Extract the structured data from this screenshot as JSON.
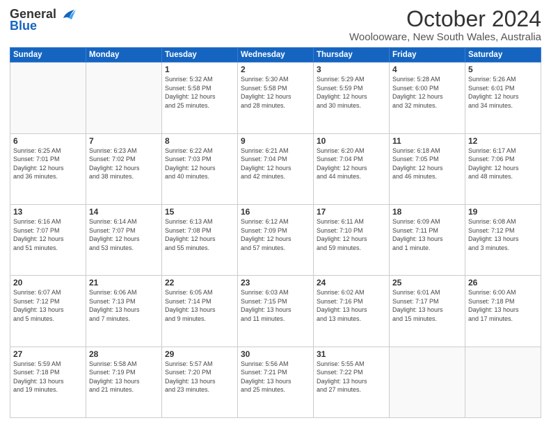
{
  "header": {
    "logo": {
      "general": "General",
      "blue": "Blue"
    },
    "title": "October 2024",
    "subtitle": "Woolooware, New South Wales, Australia"
  },
  "calendar": {
    "headers": [
      "Sunday",
      "Monday",
      "Tuesday",
      "Wednesday",
      "Thursday",
      "Friday",
      "Saturday"
    ],
    "weeks": [
      [
        {
          "day": "",
          "info": ""
        },
        {
          "day": "",
          "info": ""
        },
        {
          "day": "1",
          "info": "Sunrise: 5:32 AM\nSunset: 5:58 PM\nDaylight: 12 hours\nand 25 minutes."
        },
        {
          "day": "2",
          "info": "Sunrise: 5:30 AM\nSunset: 5:58 PM\nDaylight: 12 hours\nand 28 minutes."
        },
        {
          "day": "3",
          "info": "Sunrise: 5:29 AM\nSunset: 5:59 PM\nDaylight: 12 hours\nand 30 minutes."
        },
        {
          "day": "4",
          "info": "Sunrise: 5:28 AM\nSunset: 6:00 PM\nDaylight: 12 hours\nand 32 minutes."
        },
        {
          "day": "5",
          "info": "Sunrise: 5:26 AM\nSunset: 6:01 PM\nDaylight: 12 hours\nand 34 minutes."
        }
      ],
      [
        {
          "day": "6",
          "info": "Sunrise: 6:25 AM\nSunset: 7:01 PM\nDaylight: 12 hours\nand 36 minutes."
        },
        {
          "day": "7",
          "info": "Sunrise: 6:23 AM\nSunset: 7:02 PM\nDaylight: 12 hours\nand 38 minutes."
        },
        {
          "day": "8",
          "info": "Sunrise: 6:22 AM\nSunset: 7:03 PM\nDaylight: 12 hours\nand 40 minutes."
        },
        {
          "day": "9",
          "info": "Sunrise: 6:21 AM\nSunset: 7:04 PM\nDaylight: 12 hours\nand 42 minutes."
        },
        {
          "day": "10",
          "info": "Sunrise: 6:20 AM\nSunset: 7:04 PM\nDaylight: 12 hours\nand 44 minutes."
        },
        {
          "day": "11",
          "info": "Sunrise: 6:18 AM\nSunset: 7:05 PM\nDaylight: 12 hours\nand 46 minutes."
        },
        {
          "day": "12",
          "info": "Sunrise: 6:17 AM\nSunset: 7:06 PM\nDaylight: 12 hours\nand 48 minutes."
        }
      ],
      [
        {
          "day": "13",
          "info": "Sunrise: 6:16 AM\nSunset: 7:07 PM\nDaylight: 12 hours\nand 51 minutes."
        },
        {
          "day": "14",
          "info": "Sunrise: 6:14 AM\nSunset: 7:07 PM\nDaylight: 12 hours\nand 53 minutes."
        },
        {
          "day": "15",
          "info": "Sunrise: 6:13 AM\nSunset: 7:08 PM\nDaylight: 12 hours\nand 55 minutes."
        },
        {
          "day": "16",
          "info": "Sunrise: 6:12 AM\nSunset: 7:09 PM\nDaylight: 12 hours\nand 57 minutes."
        },
        {
          "day": "17",
          "info": "Sunrise: 6:11 AM\nSunset: 7:10 PM\nDaylight: 12 hours\nand 59 minutes."
        },
        {
          "day": "18",
          "info": "Sunrise: 6:09 AM\nSunset: 7:11 PM\nDaylight: 13 hours\nand 1 minute."
        },
        {
          "day": "19",
          "info": "Sunrise: 6:08 AM\nSunset: 7:12 PM\nDaylight: 13 hours\nand 3 minutes."
        }
      ],
      [
        {
          "day": "20",
          "info": "Sunrise: 6:07 AM\nSunset: 7:12 PM\nDaylight: 13 hours\nand 5 minutes."
        },
        {
          "day": "21",
          "info": "Sunrise: 6:06 AM\nSunset: 7:13 PM\nDaylight: 13 hours\nand 7 minutes."
        },
        {
          "day": "22",
          "info": "Sunrise: 6:05 AM\nSunset: 7:14 PM\nDaylight: 13 hours\nand 9 minutes."
        },
        {
          "day": "23",
          "info": "Sunrise: 6:03 AM\nSunset: 7:15 PM\nDaylight: 13 hours\nand 11 minutes."
        },
        {
          "day": "24",
          "info": "Sunrise: 6:02 AM\nSunset: 7:16 PM\nDaylight: 13 hours\nand 13 minutes."
        },
        {
          "day": "25",
          "info": "Sunrise: 6:01 AM\nSunset: 7:17 PM\nDaylight: 13 hours\nand 15 minutes."
        },
        {
          "day": "26",
          "info": "Sunrise: 6:00 AM\nSunset: 7:18 PM\nDaylight: 13 hours\nand 17 minutes."
        }
      ],
      [
        {
          "day": "27",
          "info": "Sunrise: 5:59 AM\nSunset: 7:18 PM\nDaylight: 13 hours\nand 19 minutes."
        },
        {
          "day": "28",
          "info": "Sunrise: 5:58 AM\nSunset: 7:19 PM\nDaylight: 13 hours\nand 21 minutes."
        },
        {
          "day": "29",
          "info": "Sunrise: 5:57 AM\nSunset: 7:20 PM\nDaylight: 13 hours\nand 23 minutes."
        },
        {
          "day": "30",
          "info": "Sunrise: 5:56 AM\nSunset: 7:21 PM\nDaylight: 13 hours\nand 25 minutes."
        },
        {
          "day": "31",
          "info": "Sunrise: 5:55 AM\nSunset: 7:22 PM\nDaylight: 13 hours\nand 27 minutes."
        },
        {
          "day": "",
          "info": ""
        },
        {
          "day": "",
          "info": ""
        }
      ]
    ]
  }
}
